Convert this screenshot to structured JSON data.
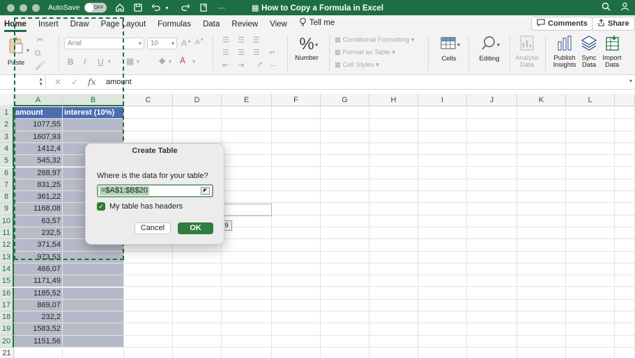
{
  "titlebar": {
    "autosave_label": "AutoSave",
    "autosave_state": "OFF",
    "doc_title": "How to Copy a Formula in Excel"
  },
  "tabs": [
    {
      "label": "Home",
      "active": true
    },
    {
      "label": "Insert"
    },
    {
      "label": "Draw"
    },
    {
      "label": "Page Layout"
    },
    {
      "label": "Formulas"
    },
    {
      "label": "Data"
    },
    {
      "label": "Review"
    },
    {
      "label": "View"
    }
  ],
  "tell_me": "Tell me",
  "comments_label": "Comments",
  "share_label": "Share",
  "ribbon": {
    "paste": "Paste",
    "font_name": "Arial",
    "font_size": "10",
    "number": "Number",
    "conditional_formatting": "Conditional Formatting",
    "format_as_table": "Format as Table",
    "cell_styles": "Cell Styles",
    "cells": "Cells",
    "editing": "Editing",
    "analyse_data_1": "Analyse",
    "analyse_data_2": "Data",
    "publish_1": "Publish",
    "publish_2": "Insights",
    "sync_1": "Sync",
    "sync_2": "Data",
    "import_1": "Import",
    "import_2": "Data"
  },
  "formula_bar": {
    "name_box": "",
    "fx": "fx",
    "content": "amount"
  },
  "columns": [
    "A",
    "B",
    "C",
    "D",
    "E",
    "F",
    "G",
    "H",
    "I",
    "J",
    "K",
    "L"
  ],
  "rows": [
    "1",
    "2",
    "3",
    "4",
    "5",
    "6",
    "7",
    "8",
    "9",
    "10",
    "11",
    "12",
    "13",
    "14",
    "15",
    "16",
    "17",
    "18",
    "19",
    "20",
    "21"
  ],
  "table": {
    "header_a": "amount",
    "header_b": "interest (10%)",
    "values": [
      "1077,55",
      "1607,93",
      "1412,4",
      "545,32",
      "288,97",
      "831,25",
      "361,22",
      "1168,08",
      "63,57",
      "232,5",
      "371,54",
      "973,53",
      "466,07",
      "1171,49",
      "1185,52",
      "869,07",
      "232,2",
      "1583,52",
      "1151,56"
    ]
  },
  "dialog": {
    "title": "Create Table",
    "question": "Where is the data for your table?",
    "range": "=$A$1:$B$20",
    "headers_label": "My table has headers",
    "headers_checked": true,
    "cancel": "Cancel",
    "ok": "OK"
  },
  "tooltip": "E9"
}
